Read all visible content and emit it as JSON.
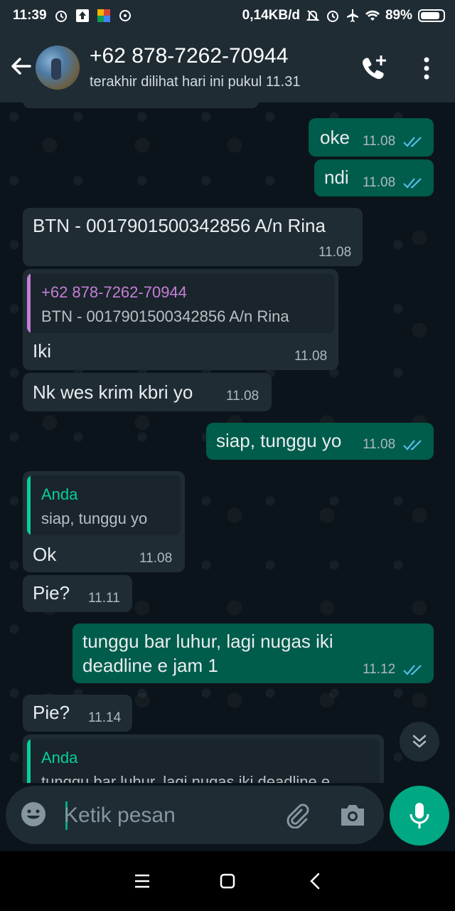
{
  "status_bar": {
    "time": "11:39",
    "net_speed": "0,14KB/d",
    "battery": "89%"
  },
  "header": {
    "contact_name": "+62 878-7262-70944",
    "last_seen": "terakhir dilihat hari ini pukul 11.31"
  },
  "messages": [
    {
      "dir": "out",
      "text": "oke",
      "time": "11.08",
      "read": true
    },
    {
      "dir": "out",
      "text": "ndi",
      "time": "11.08",
      "read": true
    },
    {
      "dir": "in",
      "text": "BTN - 0017901500342856 A/n Rina",
      "time": "11.08"
    },
    {
      "dir": "in",
      "quote_author": "+62 878-7262-70944",
      "quote_text": "BTN - 0017901500342856 A/n Rina",
      "text": "Iki",
      "time": "11.08"
    },
    {
      "dir": "in",
      "text": "Nk wes krim kbri yo",
      "time": "11.08"
    },
    {
      "dir": "out",
      "text": "siap, tunggu yo",
      "time": "11.08",
      "read": true
    },
    {
      "dir": "in",
      "quote_author": "Anda",
      "quote_text": "siap, tunggu yo",
      "text": "Ok",
      "time": "11.08"
    },
    {
      "dir": "in",
      "text": "Pie?",
      "time": "11.11"
    },
    {
      "dir": "out",
      "text_line1": "tunggu bar luhur, lagi nugas iki",
      "text_line2": "deadline e jam 1",
      "time": "11.12",
      "read": true
    },
    {
      "dir": "in",
      "text": "Pie?",
      "time": "11.14"
    },
    {
      "dir": "in",
      "quote_author": "Anda",
      "quote_text": "tunggu bar luhur, lagi nugas iki deadline e"
    }
  ],
  "composer": {
    "placeholder": "Ketik pesan"
  },
  "colors": {
    "background": "#0b141a",
    "header": "#1f2c34",
    "incoming_bubble": "#1f2c34",
    "outgoing_bubble": "#005c4b",
    "accent": "#00a884",
    "read_ticks": "#53bdeb",
    "quote_author_contact": "#c47fd5",
    "quote_author_self": "#06cf9c"
  }
}
